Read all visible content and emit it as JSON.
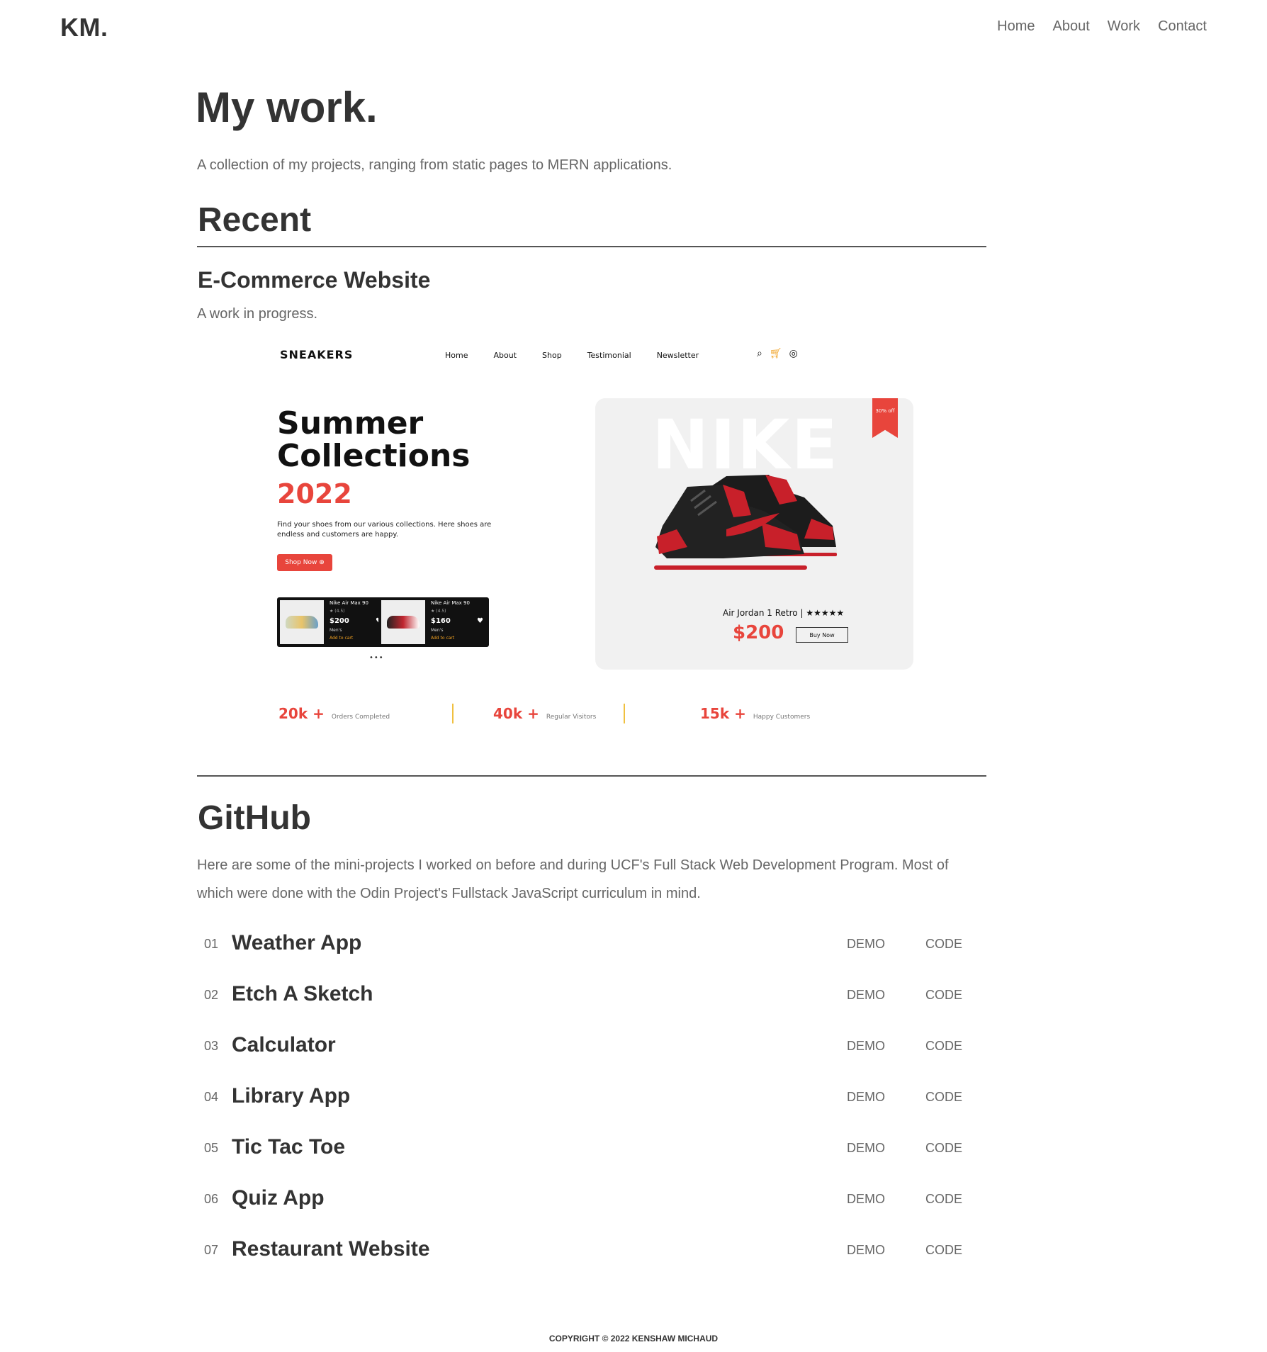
{
  "header": {
    "logo": "KM.",
    "nav": [
      "Home",
      "About",
      "Work",
      "Contact"
    ]
  },
  "page": {
    "title": "My work.",
    "subtitle": "A collection of my projects, ranging from static pages to MERN applications."
  },
  "recent": {
    "heading": "Recent",
    "project_title": "E-Commerce Website",
    "project_desc": "A work in progress.",
    "preview": {
      "brand": "SNEAKERS",
      "nav": [
        "Home",
        "About",
        "Shop",
        "Testimonial",
        "Newsletter"
      ],
      "icons": [
        "search-icon",
        "cart-icon",
        "user-icon"
      ],
      "hero_line1": "Summer",
      "hero_line2": "Collections",
      "hero_year": "2022",
      "hero_text": "Find your shoes from our various collections. Here shoes are endless and customers are happy.",
      "shop_button": "Shop Now ⊕",
      "cards": [
        {
          "name": "Nike Air Max 90",
          "rating": "★ (4.5)",
          "price": "$200",
          "category": "Men's",
          "cta": "Add to cart"
        },
        {
          "name": "Nike Air Max 90",
          "rating": "★ (4.5)",
          "price": "$160",
          "category": "Men's",
          "cta": "Add to cart"
        }
      ],
      "carousel_dots": "•••",
      "brand_watermark": "NIKE",
      "discount": "30% off",
      "product_name": "Air Jordan 1 Retro",
      "product_stars": "★★★★★",
      "product_price": "$200",
      "buy_button": "Buy Now",
      "stats": [
        {
          "value": "20k +",
          "label": "Orders Completed"
        },
        {
          "value": "40k +",
          "label": "Regular Visitors"
        },
        {
          "value": "15k +",
          "label": "Happy Customers"
        }
      ],
      "colors": {
        "accent": "#e8453c",
        "cart": "#f0a020",
        "divider": "#f0c040"
      }
    }
  },
  "github": {
    "heading": "GitHub",
    "description": "Here are some of the mini-projects I worked on before and during UCF's Full Stack Web Development Program. Most of which were done with the Odin Project's Fullstack JavaScript curriculum in mind.",
    "repos": [
      {
        "num": "01",
        "name": "Weather App",
        "demo": "DEMO",
        "code": "CODE"
      },
      {
        "num": "02",
        "name": "Etch A Sketch",
        "demo": "DEMO",
        "code": "CODE"
      },
      {
        "num": "03",
        "name": "Calculator",
        "demo": "DEMO",
        "code": "CODE"
      },
      {
        "num": "04",
        "name": "Library App",
        "demo": "DEMO",
        "code": "CODE"
      },
      {
        "num": "05",
        "name": "Tic Tac Toe",
        "demo": "DEMO",
        "code": "CODE"
      },
      {
        "num": "06",
        "name": "Quiz App",
        "demo": "DEMO",
        "code": "CODE"
      },
      {
        "num": "07",
        "name": "Restaurant Website",
        "demo": "DEMO",
        "code": "CODE"
      }
    ]
  },
  "footer": {
    "copyright": "COPYRIGHT © 2022 KENSHAW MICHAUD"
  }
}
